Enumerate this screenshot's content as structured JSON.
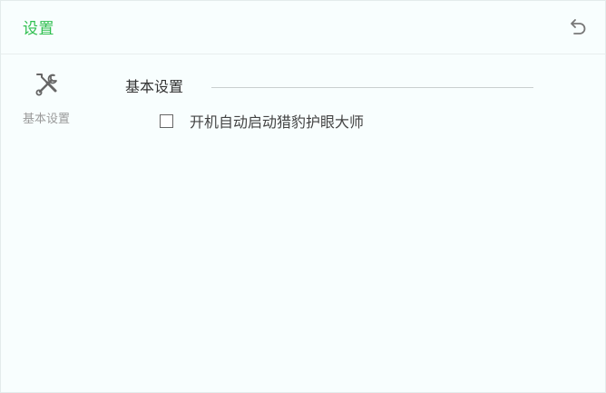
{
  "window": {
    "title": "设置",
    "back_icon": "undo-icon"
  },
  "sidebar": {
    "items": [
      {
        "label": "基本设置",
        "icon": "tools-icon",
        "active": true
      }
    ]
  },
  "content": {
    "section_title": "基本设置",
    "options": [
      {
        "label": "开机自动启动猎豹护眼大师",
        "checked": false
      }
    ]
  },
  "colors": {
    "accent": "#2fbf4f",
    "background": "#f8fefe",
    "divider": "#c9cfcf"
  }
}
